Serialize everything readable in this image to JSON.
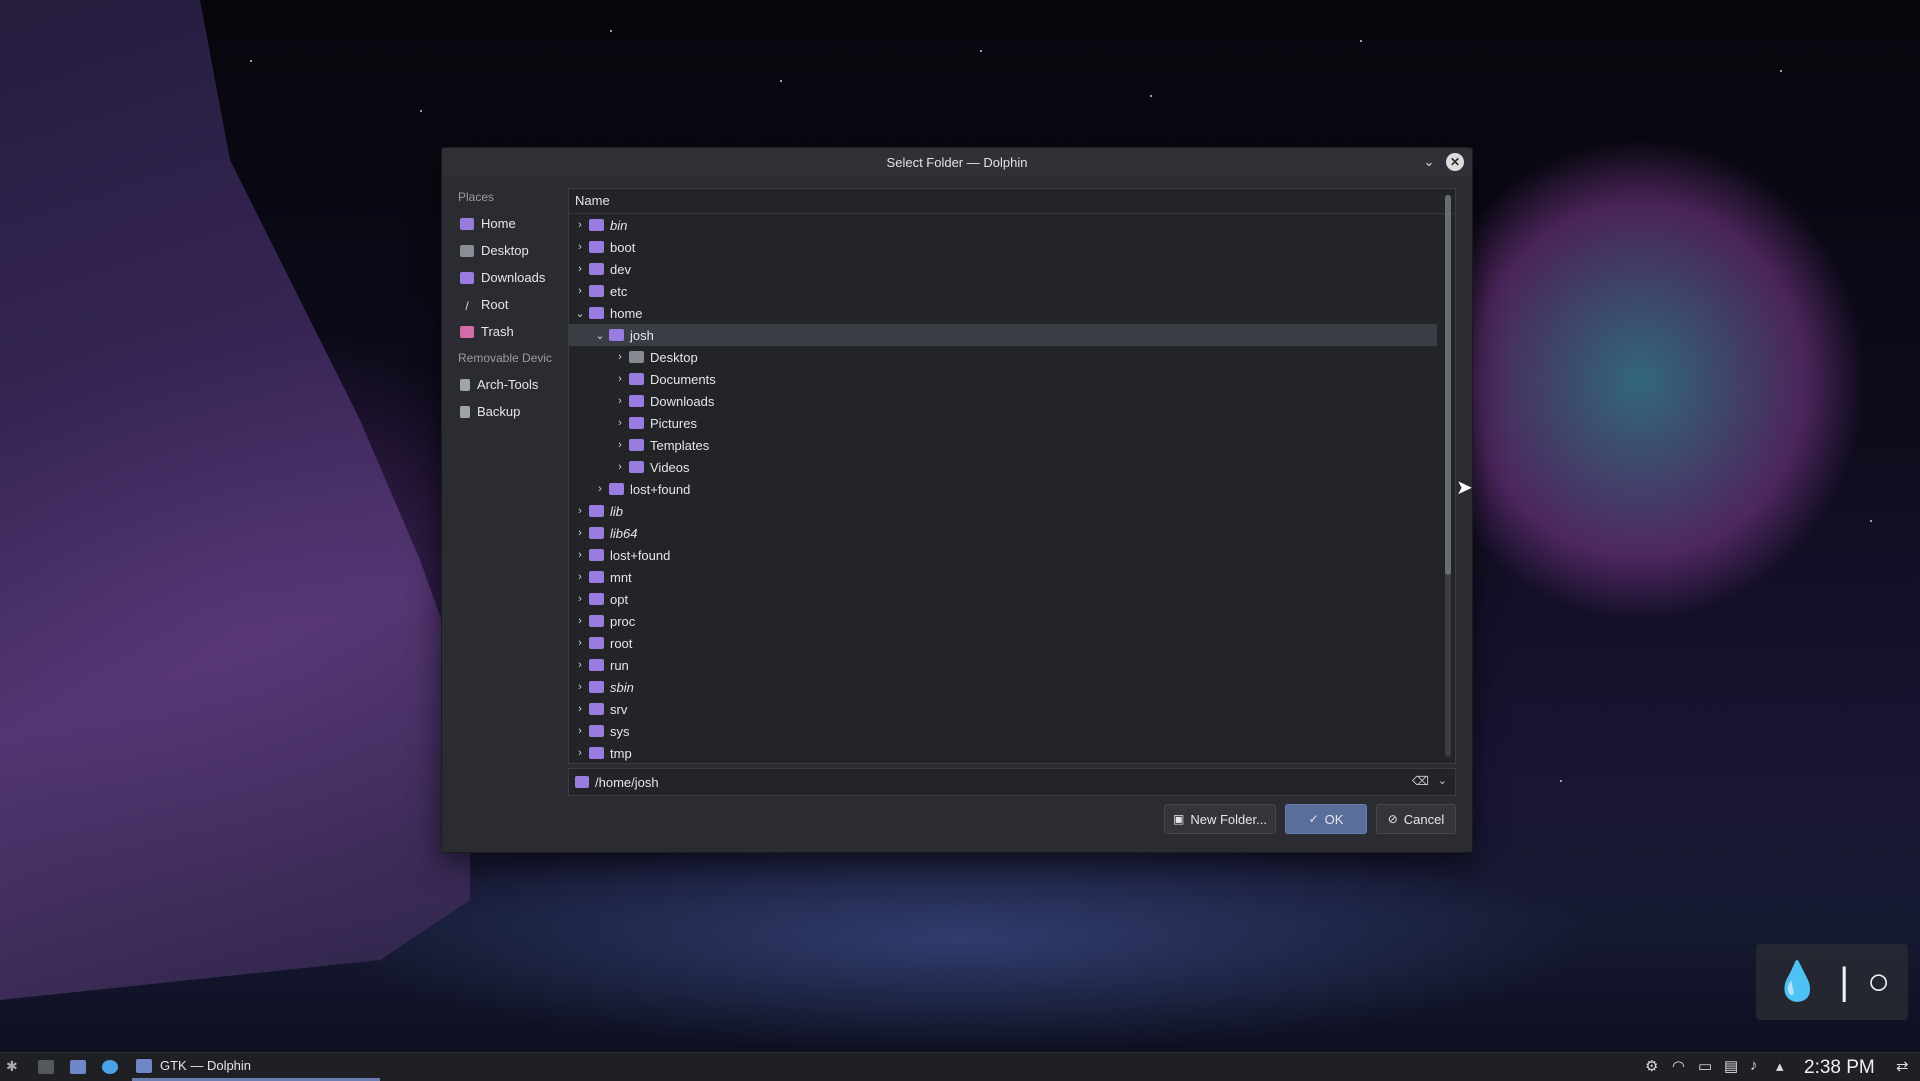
{
  "dialog": {
    "title": "Select Folder — Dolphin",
    "places_header": "Places",
    "places": [
      {
        "label": "Home",
        "icon": "home-folder-icon"
      },
      {
        "label": "Desktop",
        "icon": "desktop-icon"
      },
      {
        "label": "Downloads",
        "icon": "downloads-folder-icon"
      },
      {
        "label": "Root",
        "icon": "root-icon"
      },
      {
        "label": "Trash",
        "icon": "trash-icon"
      }
    ],
    "removable_header": "Removable Devic",
    "removable": [
      {
        "label": "Arch-Tools",
        "icon": "drive-icon"
      },
      {
        "label": "Backup",
        "icon": "drive-icon"
      }
    ],
    "tree_header": "Name",
    "tree": {
      "bin": "bin",
      "boot": "boot",
      "dev": "dev",
      "etc": "etc",
      "home": "home",
      "josh": "josh",
      "desktop": "Desktop",
      "documents": "Documents",
      "downloads": "Downloads",
      "pictures": "Pictures",
      "templates": "Templates",
      "videos": "Videos",
      "lostfound_home": "lost+found",
      "lib": "lib",
      "lib64": "lib64",
      "lostfound": "lost+found",
      "mnt": "mnt",
      "opt": "opt",
      "proc": "proc",
      "root": "root",
      "run": "run",
      "sbin": "sbin",
      "srv": "srv",
      "sys": "sys",
      "tmp": "tmp"
    },
    "path_value": "/home/josh",
    "buttons": {
      "new_folder": "New Folder...",
      "ok": "OK",
      "cancel": "Cancel"
    }
  },
  "taskbar": {
    "task_label": "GTK — Dolphin",
    "clock": "2:38 PM"
  }
}
